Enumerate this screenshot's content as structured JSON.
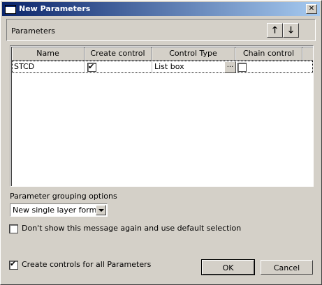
{
  "window": {
    "title": "New Parameters",
    "close_glyph": "✕"
  },
  "params_section": {
    "label": "Parameters",
    "move_up_glyph": "🡑",
    "move_down_glyph": "🡓"
  },
  "grid": {
    "columns": [
      "Name",
      "Create control",
      "Control Type",
      "Chain control"
    ],
    "rows": [
      {
        "name": "STCD",
        "create_control": true,
        "control_type": "List box",
        "chain_control": false
      }
    ],
    "ellipsis_label": "..."
  },
  "grouping": {
    "label": "Parameter grouping options",
    "selected": "New single layer form"
  },
  "dont_show": {
    "label": "Don't show this message again and use default selection",
    "checked": false
  },
  "create_all": {
    "label": "Create controls for all Parameters",
    "checked": true
  },
  "buttons": {
    "ok": "OK",
    "cancel": "Cancel"
  }
}
